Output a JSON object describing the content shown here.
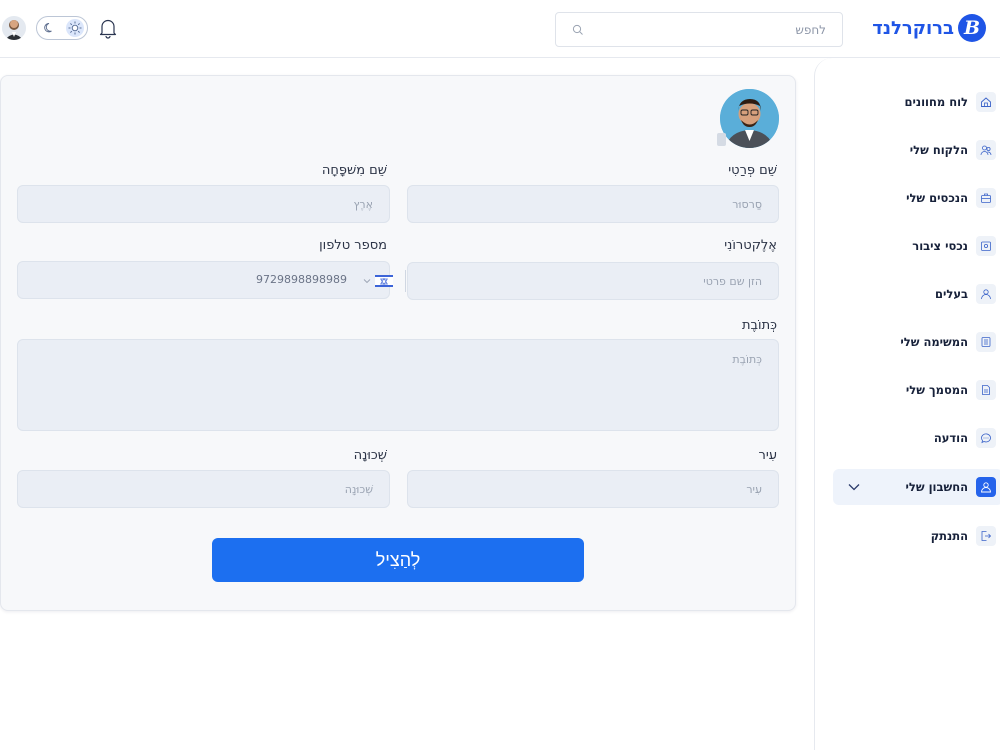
{
  "header": {
    "brand": {
      "logo_letter": "B",
      "name": "ברוקרלנד"
    },
    "search": {
      "placeholder": "לחפש"
    },
    "icons": [
      "user-avatar",
      "moon-icon",
      "sun-icon",
      "bell-icon"
    ]
  },
  "sidebar": {
    "items": [
      {
        "label": "לוח מחוונים",
        "icon": "home-icon"
      },
      {
        "label": "הלקוח שלי",
        "icon": "users-icon"
      },
      {
        "label": "הנכסים שלי",
        "icon": "briefcase-icon"
      },
      {
        "label": "נכסי ציבור",
        "icon": "building-icon"
      },
      {
        "label": "בעלים",
        "icon": "user-icon"
      },
      {
        "label": "המשימה שלי",
        "icon": "list-icon"
      },
      {
        "label": "המסמך שלי",
        "icon": "document-icon"
      },
      {
        "label": "הודעה",
        "icon": "chat-icon"
      },
      {
        "label": "החשבון שלי",
        "icon": "account-icon",
        "active": true
      },
      {
        "label": "התנתק",
        "icon": "logout-icon"
      }
    ]
  },
  "form": {
    "first_name": {
      "label": "שֵׁם פְּרַטִי",
      "placeholder": "סַרסוּר"
    },
    "last_name": {
      "label": "שֵׁם מִשׁפָּחָה",
      "placeholder": "אֶרֶץ"
    },
    "email": {
      "label": "אֶלֶקטרוֹנִי",
      "placeholder": "הזן שם פרטי"
    },
    "phone": {
      "label": "מספר טלפון",
      "value": "9729898898989"
    },
    "address": {
      "label": "כְּתוֹבֶת",
      "placeholder": "כְּתוֹבֶת"
    },
    "city": {
      "label": "עִיר",
      "placeholder": "עִיר"
    },
    "neighborhood": {
      "label": "שְׁכוּנָה",
      "placeholder": "שְׁכוּנָה"
    },
    "save_label": "לְהַצִיל"
  },
  "colors": {
    "accent": "#1c6ff0",
    "brand": "#1f55e6",
    "field_bg": "#eaeef5"
  }
}
